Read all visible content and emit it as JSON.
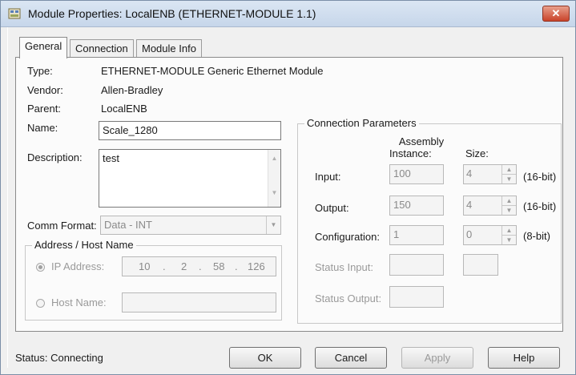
{
  "window": {
    "title": "Module Properties: LocalENB (ETHERNET-MODULE 1.1)",
    "close": "✕"
  },
  "tabs": [
    "General",
    "Connection",
    "Module Info"
  ],
  "general": {
    "type_label": "Type:",
    "type_value": "ETHERNET-MODULE Generic Ethernet Module",
    "vendor_label": "Vendor:",
    "vendor_value": "Allen-Bradley",
    "parent_label": "Parent:",
    "parent_value": "LocalENB",
    "name_label": "Name:",
    "name_value": "Scale_1280",
    "description_label": "Description:",
    "description_value": "test",
    "comm_format_label": "Comm Format:",
    "comm_format_value": "Data - INT",
    "address_group": "Address / Host Name",
    "ip_label": "IP Address:",
    "ip_octets": [
      "10",
      "2",
      "58",
      "126"
    ],
    "ip_dot": ".",
    "host_label": "Host Name:"
  },
  "conn_params": {
    "title": "Connection Parameters",
    "col_assembly": "Assembly\nInstance:",
    "col_assembly_1": "Assembly",
    "col_assembly_2": "Instance:",
    "col_size": "Size:",
    "rows": [
      {
        "label": "Input:",
        "instance": "100",
        "size": "4",
        "unit": "(16-bit)"
      },
      {
        "label": "Output:",
        "instance": "150",
        "size": "4",
        "unit": "(16-bit)"
      },
      {
        "label": "Configuration:",
        "instance": "1",
        "size": "0",
        "unit": "(8-bit)"
      }
    ],
    "status_input_label": "Status Input:",
    "status_output_label": "Status Output:"
  },
  "footer": {
    "status": "Status:  Connecting",
    "ok": "OK",
    "cancel": "Cancel",
    "apply": "Apply",
    "help": "Help"
  },
  "icons": {
    "app": "module-app-icon",
    "close": "close-icon",
    "up": "▲",
    "down": "▼",
    "dropdown": "▼"
  }
}
